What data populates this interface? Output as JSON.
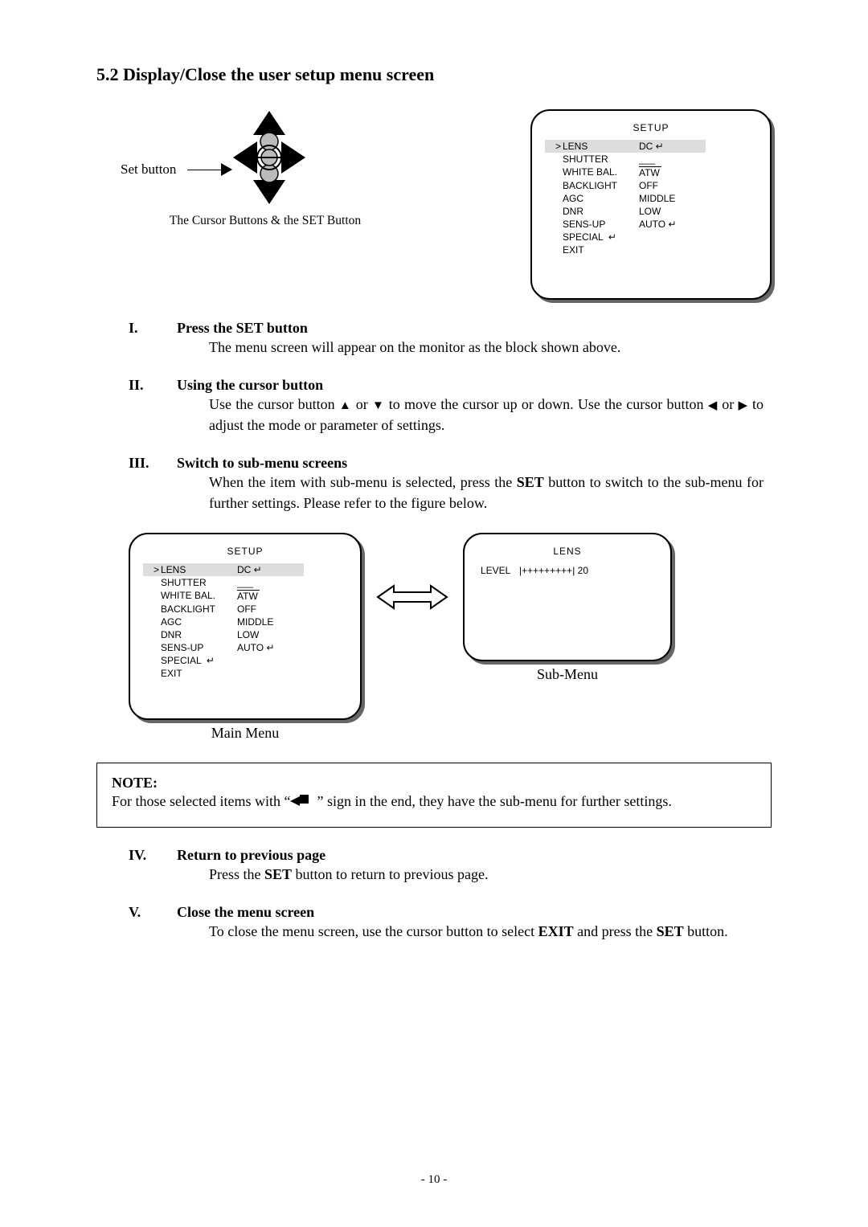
{
  "heading": "5.2 Display/Close the user setup menu screen",
  "topLeft": {
    "setButtonLabel": "Set button",
    "caption": "The Cursor Buttons & the SET Button"
  },
  "setupMenu": {
    "title": "SETUP",
    "rows": [
      {
        "cursor": ">",
        "label": "LENS",
        "value": "DC ↵",
        "selected": true
      },
      {
        "cursor": "",
        "label": "SHUTTER",
        "value": "___",
        "selected": false
      },
      {
        "cursor": "",
        "label": "WHITE BAL.",
        "value": "ATW",
        "selected": false,
        "overline": true
      },
      {
        "cursor": "",
        "label": "BACKLIGHT",
        "value": "OFF",
        "selected": false
      },
      {
        "cursor": "",
        "label": "AGC",
        "value": "MIDDLE",
        "selected": false
      },
      {
        "cursor": "",
        "label": "DNR",
        "value": "LOW",
        "selected": false
      },
      {
        "cursor": "",
        "label": "SENS-UP",
        "value": "AUTO ↵",
        "selected": false
      },
      {
        "cursor": "",
        "label": "SPECIAL ↵",
        "value": "",
        "selected": false
      },
      {
        "cursor": "",
        "label": "EXIT",
        "value": "",
        "selected": false
      }
    ]
  },
  "subMenu": {
    "title": "LENS",
    "levelLabel": "LEVEL",
    "levelBar": "|+++++++++| 20"
  },
  "captions": {
    "mainMenu": "Main Menu",
    "subMenu": "Sub-Menu"
  },
  "steps": {
    "I": {
      "title": "Press the SET button",
      "body": "The menu screen will appear on the monitor as the block shown above."
    },
    "II": {
      "title": "Using the cursor button",
      "pre": "Use the cursor button ",
      "mid1": " or ",
      "mid2": " to move the cursor up or down. Use the cursor button ",
      "mid3": " or ",
      "end": " to adjust the mode or parameter of settings."
    },
    "III": {
      "title": "Switch to sub-menu screens",
      "pre": "When the item with sub-menu is selected, press the ",
      "setWord": "SET",
      "end": " button to switch to the sub-menu for further settings. Please refer to the figure below."
    },
    "IV": {
      "title": "Return to previous page",
      "pre": "Press the ",
      "setWord": "SET",
      "end": " button to return to previous page."
    },
    "V": {
      "title": "Close the menu screen",
      "pre": "To close the menu screen, use the cursor button to select ",
      "exitWord": "EXIT",
      "mid": " and press the ",
      "setWord": "SET",
      "end": " button."
    }
  },
  "note": {
    "title": "NOTE:",
    "pre": "For those selected items with “",
    "post": "” sign in the end, they have the sub-menu for further settings."
  },
  "arrows": {
    "up": "▲",
    "down": "▼",
    "left": "◀",
    "right": "▶"
  },
  "footer": "- 10 -"
}
